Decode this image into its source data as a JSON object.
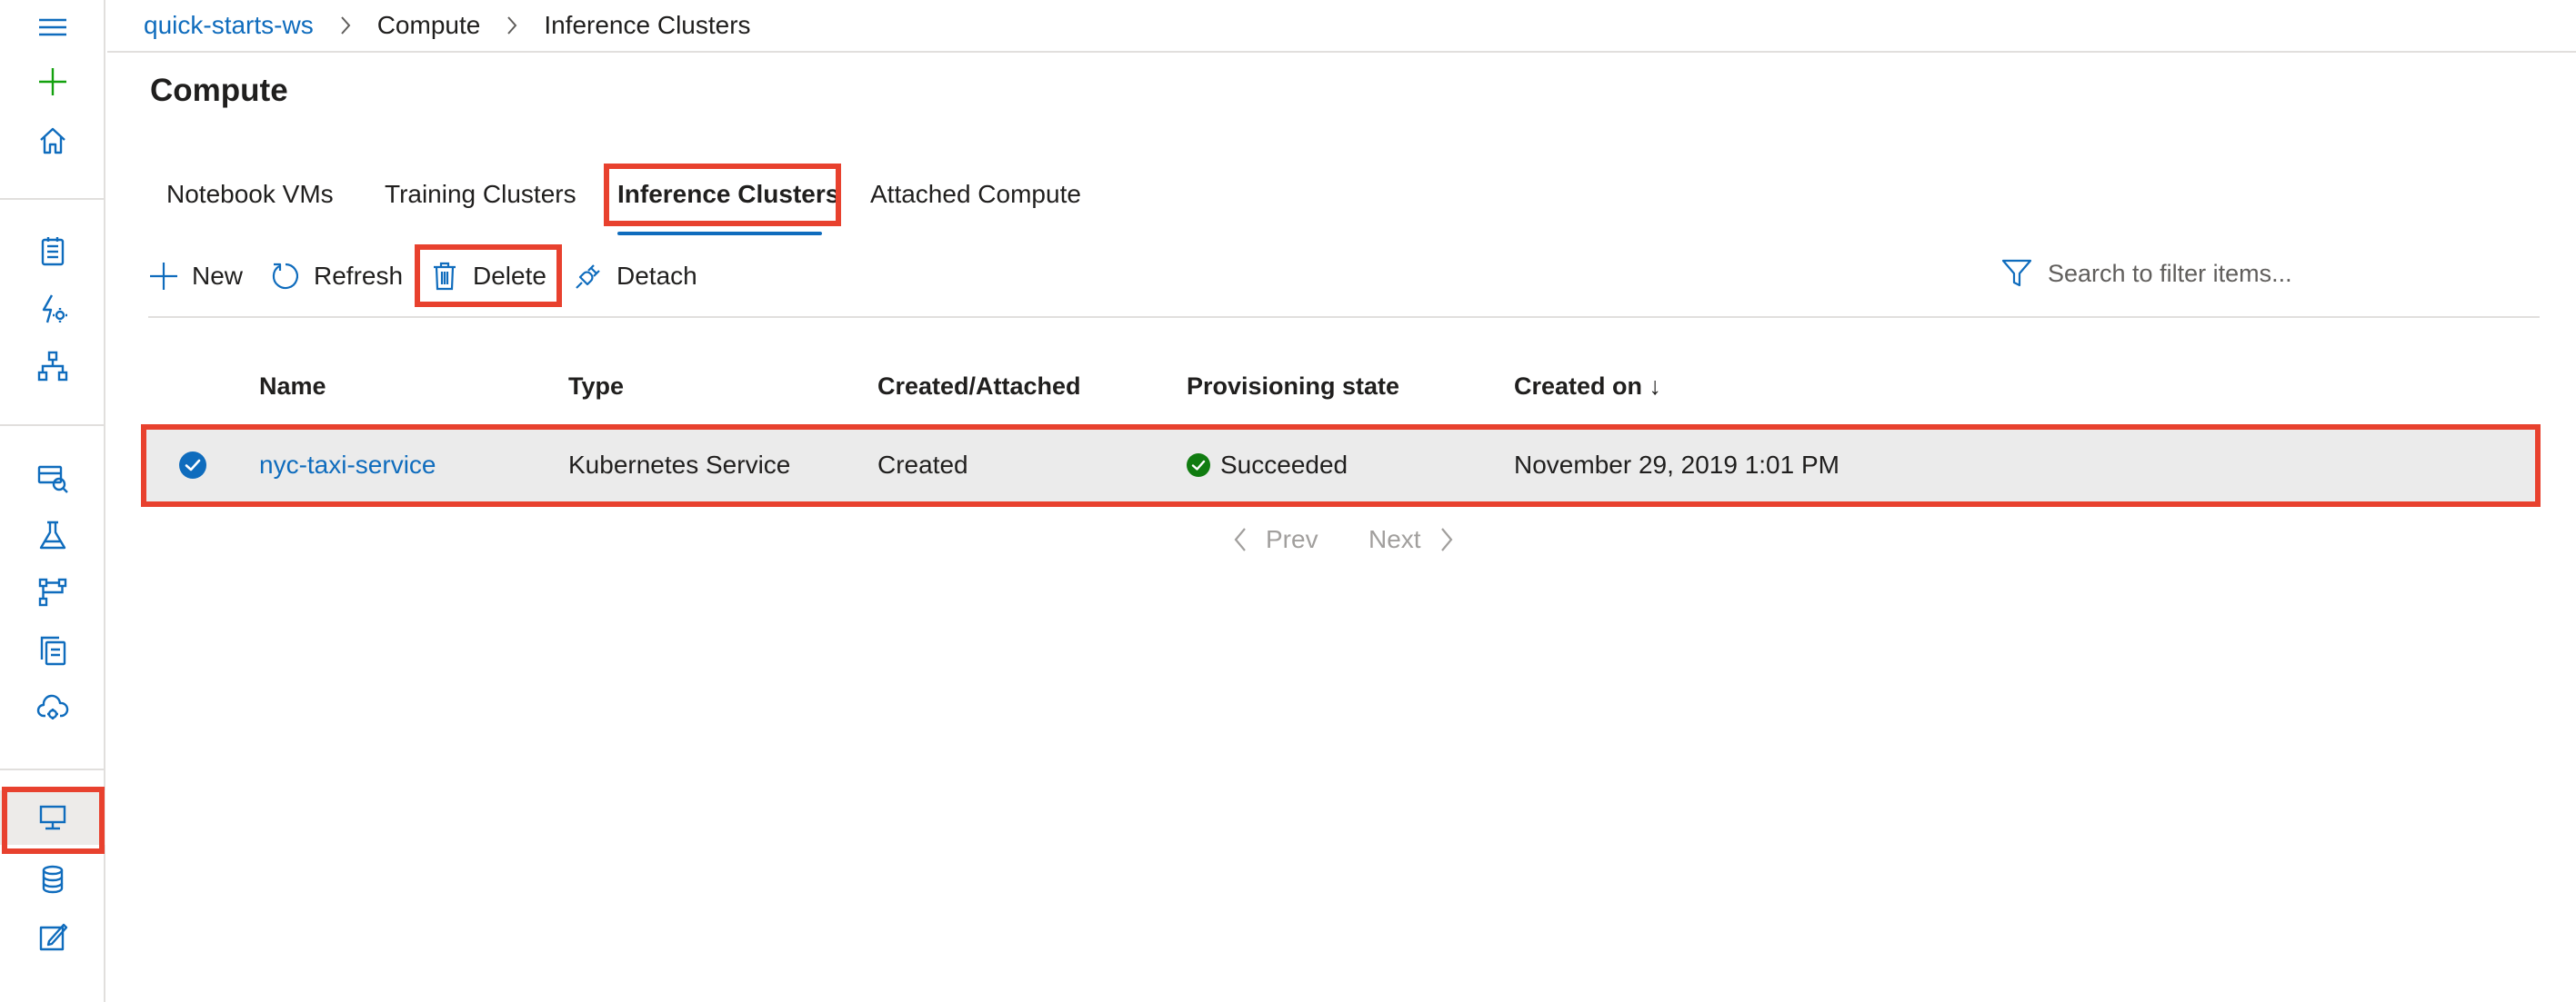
{
  "breadcrumb": {
    "workspace": "quick-starts-ws",
    "section": "Compute",
    "current": "Inference Clusters"
  },
  "page": {
    "title": "Compute"
  },
  "tabs": [
    {
      "label": "Notebook VMs",
      "active": false
    },
    {
      "label": "Training Clusters",
      "active": false
    },
    {
      "label": "Inference Clusters",
      "active": true
    },
    {
      "label": "Attached Compute",
      "active": false
    }
  ],
  "toolbar": {
    "new_label": "New",
    "refresh_label": "Refresh",
    "delete_label": "Delete",
    "detach_label": "Detach",
    "search_placeholder": "Search to filter items..."
  },
  "table": {
    "columns": [
      "Name",
      "Type",
      "Created/Attached",
      "Provisioning state",
      "Created on ↓"
    ],
    "rows": [
      {
        "selected": true,
        "name": "nyc-taxi-service",
        "type": "Kubernetes Service",
        "created_attached": "Created",
        "state": "Succeeded",
        "created_on": "November 29, 2019 1:01 PM"
      }
    ]
  },
  "pager": {
    "prev_label": "Prev",
    "next_label": "Next"
  },
  "icons": {
    "rail": [
      "menu-icon",
      "plus-icon",
      "home-icon",
      "notebook-icon",
      "automl-icon",
      "designer-icon",
      "datasets-icon",
      "experiments-icon",
      "pipelines-icon",
      "models-icon",
      "endpoints-icon",
      "compute-icon",
      "datastores-icon",
      "labeling-icon"
    ]
  },
  "colors": {
    "accent": "#0f6cbd",
    "highlight": "#e8412e",
    "success": "#107c10",
    "plus_green": "#13a10e",
    "row_selected_bg": "#ebebeb"
  }
}
